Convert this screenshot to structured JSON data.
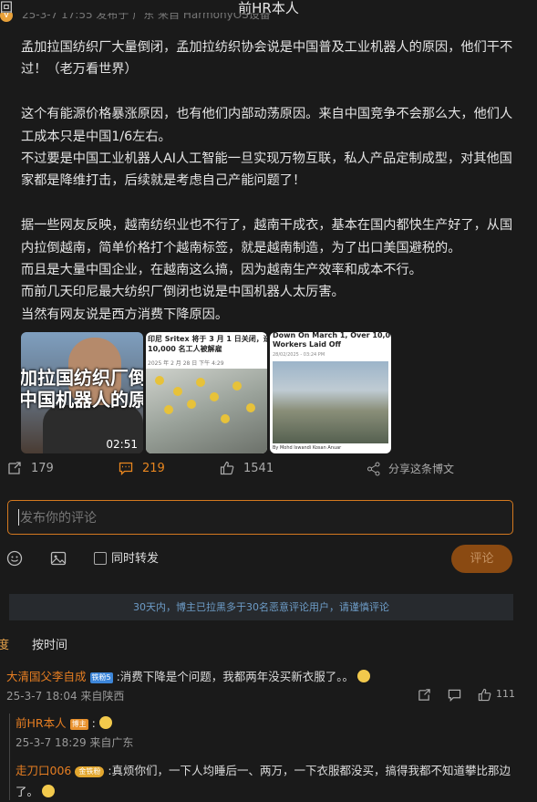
{
  "header": {
    "back_label": "回",
    "title": "前HR本人",
    "meta_partial": "25-3-7 17:55 发布于 广东 来自 HarmonyOS设备"
  },
  "post": {
    "paragraphs": [
      "孟加拉国纺织厂大量倒闭，孟加拉纺织协会说是中国普及工业机器人的原因，他们干不过！（老万看世界）",
      "",
      "这个有能源价格暴涨原因，也有他们内部动荡原因。来自中国竞争不会那么大，他们人工成本只是中国1/6左右。",
      "不过要是中国工业机器人AI人工智能一旦实现万物互联，私人产品定制成型，对其他国家都是降维打击，后续就是考虑自己产能问题了！",
      "",
      "据一些网友反映，越南纺织业也不行了，越南干成衣，基本在国内都快生产好了，从国内拉倒越南，简单价格打个越南标签，就是越南制造，为了出口美国避税的。",
      "而且是大量中国企业，在越南这么搞，因为越南生产效率和成本不行。",
      "而前几天印尼最大纺织厂倒闭也说是中国机器人太厉害。",
      "当然有网友说是西方消费下降原因。"
    ]
  },
  "images": {
    "video_caption_line1": "加拉国纺织厂倒",
    "video_caption_line2": "中国机器人的原",
    "video_duration": "02:51",
    "img2_headline_line1": "印尼 Sritex 将于 3 月 1 日关闭，造",
    "img2_headline_line2": "10,000 名工人被解雇",
    "img2_date": "2025 年 2 月 28 日 下午 4:29",
    "img3_headline_line1": "Down On March 1, Over 10,000",
    "img3_headline_line2": "Workers Laid Off",
    "img3_date": "28/02/2025 - 03:24 PM",
    "img3_credit": "By Mohd Iswandi Kosan Anuar",
    "img3_photo_credit": "Credit: Sritex"
  },
  "actions": {
    "repost_count": "179",
    "comment_count": "219",
    "like_count": "1541",
    "share_label": "分享这条博文"
  },
  "comment_form": {
    "placeholder": "发布你的评论",
    "also_repost_label": "同时转发",
    "submit_label": "评论"
  },
  "notice": "30天内，博主已拉黑多于30名恶意评论用户，请谨慎评论",
  "sort": {
    "hot_label": "按热度",
    "time_label": "按时间"
  },
  "comments": [
    {
      "user": "大清国父李自成",
      "badge": "铁粉5",
      "text": ":消费下降是个问题，我都两年没买新衣服了。。",
      "time": "25-3-7 18:04 来自陕西",
      "likes": "111",
      "replies": [
        {
          "user": "前HR本人",
          "badge": "博主",
          "text": ":",
          "time": "25-3-7 18:29 来自广东"
        },
        {
          "user": "走刀口006",
          "badge": "金铁粉",
          "text": ":真烦你们，一下人均睡后一、两万，一下衣服都没买，搞得我都不知道攀比那边了。"
        }
      ]
    }
  ],
  "colors": {
    "accent": "#e8861f",
    "username": "#e67e22",
    "notice_text": "#6d9cc7",
    "background": "#1a1a1a"
  }
}
